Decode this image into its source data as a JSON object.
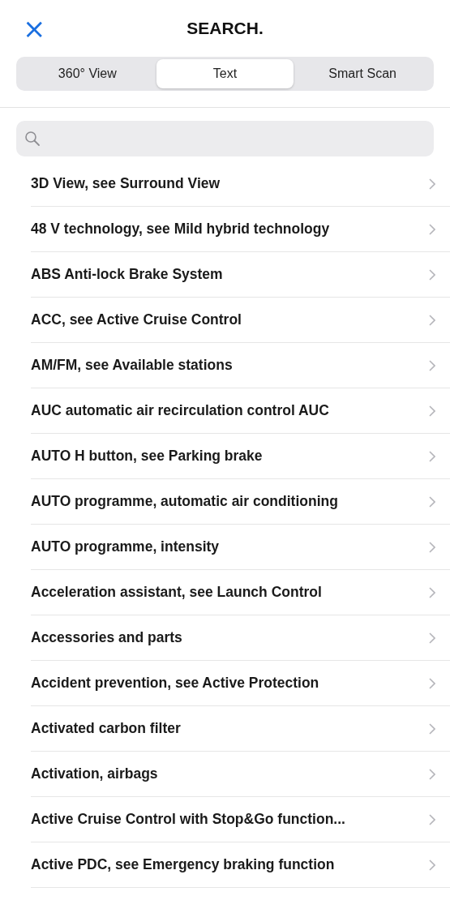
{
  "header": {
    "close": "×",
    "title": "SEARCH."
  },
  "tabs": [
    {
      "label": "360° View",
      "selected": false
    },
    {
      "label": "Text",
      "selected": true
    },
    {
      "label": "Smart Scan",
      "selected": false
    }
  ],
  "results": [
    {
      "label": "3D View, see Surround View"
    },
    {
      "label": "48 V technology, see Mild hybrid technology"
    },
    {
      "label": "ABS Anti-lock Brake System"
    },
    {
      "label": "ACC, see Active Cruise Control"
    },
    {
      "label": "AM/FM, see Available stations"
    },
    {
      "label": "AUC automatic air recirculation control AUC"
    },
    {
      "label": "AUTO H button, see Parking brake"
    },
    {
      "label": "AUTO programme, automatic air conditioning"
    },
    {
      "label": "AUTO programme, intensity"
    },
    {
      "label": "Acceleration assistant, see Launch Control"
    },
    {
      "label": "Accessories and parts"
    },
    {
      "label": "Accident prevention, see Active Protection"
    },
    {
      "label": "Activated carbon filter"
    },
    {
      "label": "Activation, airbags"
    },
    {
      "label": "Active Cruise Control with Stop&Go function..."
    },
    {
      "label": "Active PDC, see Emergency braking function"
    }
  ]
}
